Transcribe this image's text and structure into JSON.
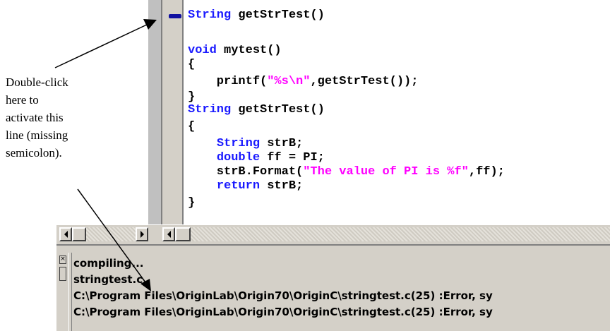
{
  "annotation": {
    "lines": [
      "Double-click",
      "here to",
      "activate this",
      "line (missing",
      "semicolon)."
    ]
  },
  "code": {
    "lines": [
      {
        "t": "String getStrTest()"
      },
      {
        "t": "void mytest()"
      },
      {
        "t": "{"
      },
      {
        "t": "    printf(",
        "s": "\"%s\\n\"",
        "r": ",getStrTest());"
      },
      {
        "t": "}"
      },
      {
        "t": "String getStrTest()"
      },
      {
        "t": "{"
      },
      {
        "t": "    String strB;"
      },
      {
        "t": "    double ff = PI;"
      },
      {
        "t": "    strB.Format(",
        "s": "\"The value of PI is %f\"",
        "r": ",ff);"
      },
      {
        "t": "    return strB;"
      },
      {
        "t": "}"
      }
    ]
  },
  "output": {
    "lines": [
      "compiling...",
      "stringtest.c",
      "C:\\Program Files\\OriginLab\\Origin70\\OriginC\\stringtest.c(25) :Error, sy",
      "C:\\Program Files\\OriginLab\\Origin70\\OriginC\\stringtest.c(25) :Error, sy"
    ]
  },
  "colors": {
    "keyword": "#1a1aff",
    "string": "#ff00ff",
    "marker": "#1010a0",
    "chrome": "#d4d0c8"
  }
}
